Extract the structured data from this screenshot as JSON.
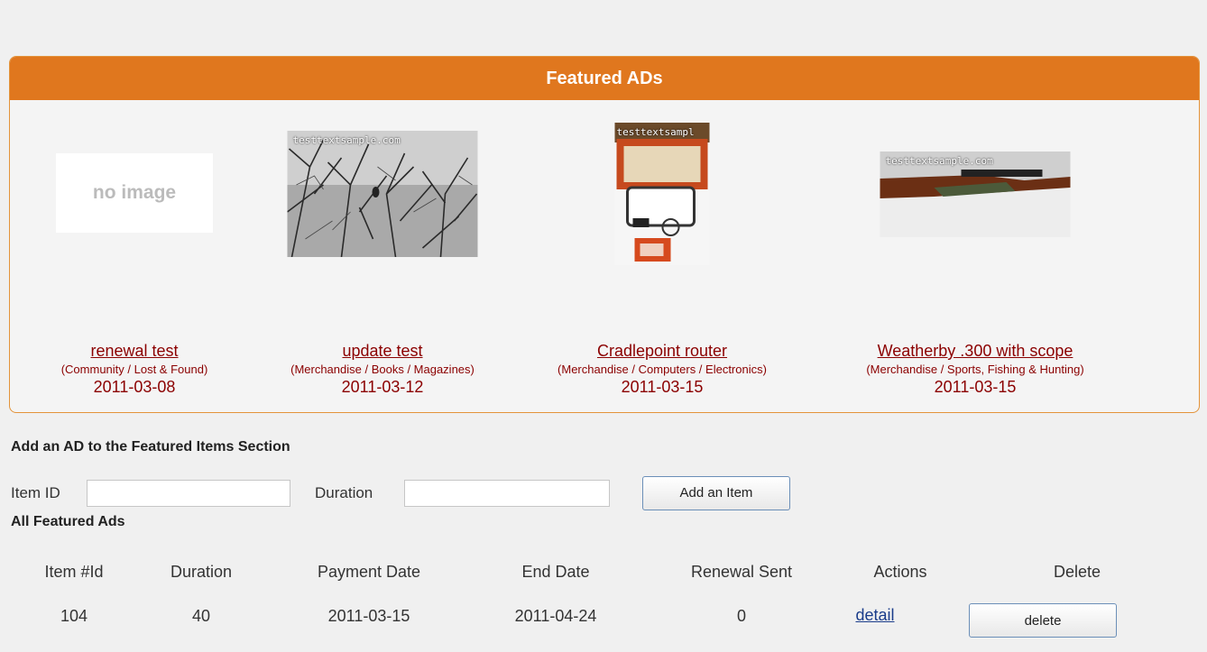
{
  "featured": {
    "title": "Featured ADs",
    "items": [
      {
        "title": "renewal test",
        "category": "(Community / Lost & Found)",
        "date": "2011-03-08",
        "image": "no image",
        "watermark": ""
      },
      {
        "title": "update test",
        "category": "(Merchandise / Books / Magazines)",
        "date": "2011-03-12",
        "image": "photo-trees",
        "watermark": "testtextsample.com"
      },
      {
        "title": "Cradlepoint router",
        "category": "(Merchandise / Computers / Electronics)",
        "date": "2011-03-15",
        "image": "photo-router",
        "watermark": "testtextsampl"
      },
      {
        "title": "Weatherby .300 with scope",
        "category": "(Merchandise / Sports, Fishing & Hunting)",
        "date": "2011-03-15",
        "image": "photo-rifle",
        "watermark": "testtextsample.com"
      }
    ]
  },
  "add_form": {
    "heading": "Add an AD to the Featured Items Section",
    "item_id_label": "Item ID",
    "item_id_value": "",
    "duration_label": "Duration",
    "duration_value": "",
    "submit_label": "Add an Item"
  },
  "table": {
    "heading": "All Featured Ads",
    "columns": [
      "Item #Id",
      "Duration",
      "Payment Date",
      "End Date",
      "Renewal Sent",
      "Actions",
      "Delete"
    ],
    "rows": [
      {
        "item_id": "104",
        "duration": "40",
        "payment_date": "2011-03-15",
        "end_date": "2011-04-24",
        "renewal_sent": "0",
        "action_label": "detail",
        "delete_label": "delete"
      }
    ]
  },
  "colors": {
    "header": "#e0771e",
    "link": "#8b0000",
    "border": "#e3933a"
  }
}
